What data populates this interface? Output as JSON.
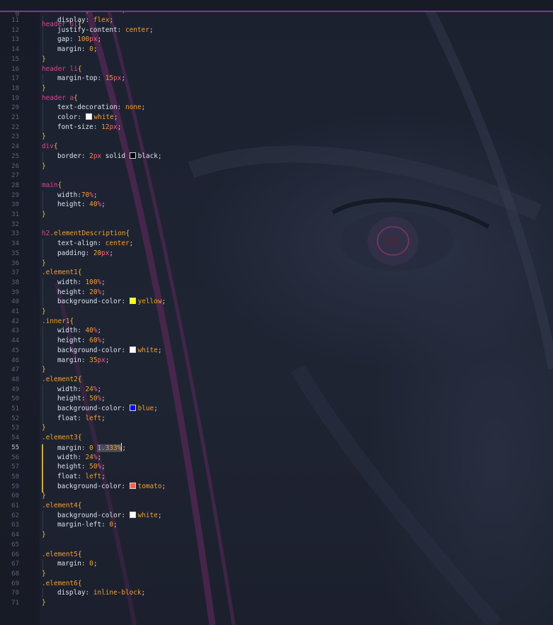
{
  "editor": {
    "active_line": "55",
    "sticky": {
      "num": "9",
      "tokens": [
        [
          "tag",
          "header "
        ],
        [
          "tag",
          "ul"
        ],
        [
          "brace",
          "{"
        ]
      ]
    },
    "partial": {
      "num": "10",
      "tokens": [
        [
          "faded",
          "    list-style: none;"
        ]
      ]
    },
    "lines": [
      {
        "num": "11",
        "indent": 1,
        "tokens": [
          [
            "prop",
            "display"
          ],
          [
            "punc",
            ": "
          ],
          [
            "val",
            "flex"
          ],
          [
            "punc",
            ";"
          ]
        ]
      },
      {
        "num": "12",
        "indent": 1,
        "tokens": [
          [
            "prop",
            "justify-content"
          ],
          [
            "punc",
            ": "
          ],
          [
            "val",
            "center"
          ],
          [
            "punc",
            ";"
          ]
        ]
      },
      {
        "num": "13",
        "indent": 1,
        "tokens": [
          [
            "prop",
            "gap"
          ],
          [
            "punc",
            ": "
          ],
          [
            "num",
            "100"
          ],
          [
            "unit",
            "px"
          ],
          [
            "punc",
            ";"
          ]
        ]
      },
      {
        "num": "14",
        "indent": 1,
        "tokens": [
          [
            "prop",
            "margin"
          ],
          [
            "punc",
            ": "
          ],
          [
            "num",
            "0"
          ],
          [
            "punc",
            ";"
          ]
        ]
      },
      {
        "num": "15",
        "indent": 0,
        "tokens": [
          [
            "brace",
            "}"
          ]
        ]
      },
      {
        "num": "16",
        "indent": 0,
        "tokens": [
          [
            "tag",
            "header "
          ],
          [
            "tag",
            "li"
          ],
          [
            "brace",
            "{"
          ]
        ]
      },
      {
        "num": "17",
        "indent": 1,
        "tokens": [
          [
            "prop",
            "margin-top"
          ],
          [
            "punc",
            ": "
          ],
          [
            "num",
            "15"
          ],
          [
            "unit",
            "px"
          ],
          [
            "punc",
            ";"
          ]
        ]
      },
      {
        "num": "18",
        "indent": 0,
        "tokens": [
          [
            "brace",
            "}"
          ]
        ]
      },
      {
        "num": "19",
        "indent": 0,
        "tokens": [
          [
            "tag",
            "header "
          ],
          [
            "tag",
            "a"
          ],
          [
            "brace",
            "{"
          ]
        ]
      },
      {
        "num": "20",
        "indent": 1,
        "tokens": [
          [
            "prop",
            "text-decoration"
          ],
          [
            "punc",
            ": "
          ],
          [
            "val",
            "none"
          ],
          [
            "punc",
            ";"
          ]
        ]
      },
      {
        "num": "21",
        "indent": 1,
        "tokens": [
          [
            "prop",
            "color"
          ],
          [
            "punc",
            ": "
          ],
          [
            "swatch",
            "#ffffff"
          ],
          [
            "val",
            "white"
          ],
          [
            "punc",
            ";"
          ]
        ]
      },
      {
        "num": "22",
        "indent": 1,
        "tokens": [
          [
            "prop",
            "font-size"
          ],
          [
            "punc",
            ": "
          ],
          [
            "num",
            "12"
          ],
          [
            "unit",
            "px"
          ],
          [
            "punc",
            ";"
          ]
        ]
      },
      {
        "num": "23",
        "indent": 0,
        "tokens": [
          [
            "brace",
            "}"
          ]
        ]
      },
      {
        "num": "24",
        "indent": 0,
        "tokens": [
          [
            "tag",
            "div"
          ],
          [
            "brace",
            "{"
          ]
        ]
      },
      {
        "num": "25",
        "indent": 1,
        "tokens": [
          [
            "prop",
            "border"
          ],
          [
            "punc",
            ": "
          ],
          [
            "num",
            "2"
          ],
          [
            "unit",
            "px"
          ],
          [
            "plain",
            " solid "
          ],
          [
            "swatch",
            "#000000"
          ],
          [
            "plain",
            "black"
          ],
          [
            "punc",
            ";"
          ]
        ]
      },
      {
        "num": "26",
        "indent": 0,
        "tokens": [
          [
            "brace",
            "}"
          ]
        ]
      },
      {
        "num": "27",
        "indent": 0,
        "tokens": []
      },
      {
        "num": "28",
        "indent": 0,
        "tokens": [
          [
            "tag",
            "main"
          ],
          [
            "brace",
            "{"
          ]
        ]
      },
      {
        "num": "29",
        "indent": 1,
        "tokens": [
          [
            "prop",
            "width"
          ],
          [
            "punc",
            ":"
          ],
          [
            "num",
            "70"
          ],
          [
            "unit",
            "%"
          ],
          [
            "punc",
            ";"
          ]
        ]
      },
      {
        "num": "30",
        "indent": 1,
        "tokens": [
          [
            "prop",
            "height"
          ],
          [
            "punc",
            ": "
          ],
          [
            "num",
            "40"
          ],
          [
            "unit",
            "%"
          ],
          [
            "punc",
            ";"
          ]
        ]
      },
      {
        "num": "31",
        "indent": 0,
        "tokens": [
          [
            "brace",
            "}"
          ]
        ]
      },
      {
        "num": "32",
        "indent": 0,
        "tokens": []
      },
      {
        "num": "33",
        "indent": 0,
        "tokens": [
          [
            "tag",
            "h2"
          ],
          [
            "cls",
            ".elementDescription"
          ],
          [
            "brace",
            "{"
          ]
        ]
      },
      {
        "num": "34",
        "indent": 1,
        "tokens": [
          [
            "prop",
            "text-align"
          ],
          [
            "punc",
            ": "
          ],
          [
            "val",
            "center"
          ],
          [
            "punc",
            ";"
          ]
        ]
      },
      {
        "num": "35",
        "indent": 1,
        "tokens": [
          [
            "prop",
            "padding"
          ],
          [
            "punc",
            ": "
          ],
          [
            "num",
            "20"
          ],
          [
            "unit",
            "px"
          ],
          [
            "punc",
            ";"
          ]
        ]
      },
      {
        "num": "36",
        "indent": 0,
        "tokens": [
          [
            "brace",
            "}"
          ]
        ]
      },
      {
        "num": "37",
        "indent": 0,
        "tokens": [
          [
            "cls",
            ".element1"
          ],
          [
            "brace",
            "{"
          ]
        ]
      },
      {
        "num": "38",
        "indent": 1,
        "tokens": [
          [
            "prop",
            "width"
          ],
          [
            "punc",
            ": "
          ],
          [
            "num",
            "100"
          ],
          [
            "unit",
            "%"
          ],
          [
            "punc",
            ";"
          ]
        ]
      },
      {
        "num": "39",
        "indent": 1,
        "tokens": [
          [
            "prop",
            "height"
          ],
          [
            "punc",
            ": "
          ],
          [
            "num",
            "20"
          ],
          [
            "unit",
            "%"
          ],
          [
            "punc",
            ";"
          ]
        ]
      },
      {
        "num": "40",
        "indent": 1,
        "tokens": [
          [
            "prop",
            "background-color"
          ],
          [
            "punc",
            ": "
          ],
          [
            "swatch",
            "#ffff00"
          ],
          [
            "val",
            "yellow"
          ],
          [
            "punc",
            ";"
          ]
        ]
      },
      {
        "num": "41",
        "indent": 0,
        "tokens": [
          [
            "brace",
            "}"
          ]
        ]
      },
      {
        "num": "42",
        "indent": 0,
        "tokens": [
          [
            "cls",
            ".inner1"
          ],
          [
            "brace",
            "{"
          ]
        ]
      },
      {
        "num": "43",
        "indent": 1,
        "tokens": [
          [
            "prop",
            "width"
          ],
          [
            "punc",
            ": "
          ],
          [
            "num",
            "40"
          ],
          [
            "unit",
            "%"
          ],
          [
            "punc",
            ";"
          ]
        ]
      },
      {
        "num": "44",
        "indent": 1,
        "tokens": [
          [
            "prop",
            "height"
          ],
          [
            "punc",
            ": "
          ],
          [
            "num",
            "60"
          ],
          [
            "unit",
            "%"
          ],
          [
            "punc",
            ";"
          ]
        ]
      },
      {
        "num": "45",
        "indent": 1,
        "tokens": [
          [
            "prop",
            "background-color"
          ],
          [
            "punc",
            ": "
          ],
          [
            "swatch",
            "#ffffff"
          ],
          [
            "val",
            "white"
          ],
          [
            "punc",
            ";"
          ]
        ]
      },
      {
        "num": "46",
        "indent": 1,
        "tokens": [
          [
            "prop",
            "margin"
          ],
          [
            "punc",
            ": "
          ],
          [
            "num",
            "35"
          ],
          [
            "unit",
            "px"
          ],
          [
            "punc",
            ";"
          ]
        ]
      },
      {
        "num": "47",
        "indent": 0,
        "tokens": [
          [
            "brace",
            "}"
          ]
        ]
      },
      {
        "num": "48",
        "indent": 0,
        "tokens": [
          [
            "cls",
            ".element2"
          ],
          [
            "brace",
            "{"
          ]
        ]
      },
      {
        "num": "49",
        "indent": 1,
        "tokens": [
          [
            "prop",
            "width"
          ],
          [
            "punc",
            ": "
          ],
          [
            "num",
            "24"
          ],
          [
            "unit",
            "%"
          ],
          [
            "punc",
            ";"
          ]
        ]
      },
      {
        "num": "50",
        "indent": 1,
        "tokens": [
          [
            "prop",
            "height"
          ],
          [
            "punc",
            ": "
          ],
          [
            "num",
            "50"
          ],
          [
            "unit",
            "%"
          ],
          [
            "punc",
            ";"
          ]
        ]
      },
      {
        "num": "51",
        "indent": 1,
        "tokens": [
          [
            "prop",
            "background-color"
          ],
          [
            "punc",
            ": "
          ],
          [
            "swatch",
            "#0000ff"
          ],
          [
            "val",
            "blue"
          ],
          [
            "punc",
            ";"
          ]
        ]
      },
      {
        "num": "52",
        "indent": 1,
        "tokens": [
          [
            "prop",
            "float"
          ],
          [
            "punc",
            ": "
          ],
          [
            "val",
            "left"
          ],
          [
            "punc",
            ";"
          ]
        ]
      },
      {
        "num": "53",
        "indent": 0,
        "tokens": [
          [
            "brace",
            "}"
          ]
        ]
      },
      {
        "num": "54",
        "indent": 0,
        "tokens": [
          [
            "cls",
            ".element3"
          ],
          [
            "brace",
            "{"
          ]
        ]
      },
      {
        "num": "55",
        "indent": 1,
        "tokens": [
          [
            "prop",
            "margin"
          ],
          [
            "punc",
            ": "
          ],
          [
            "num",
            "0 "
          ],
          [
            "hl",
            "1.333%"
          ],
          [
            "cursor",
            ""
          ],
          [
            "punc",
            ";"
          ]
        ]
      },
      {
        "num": "56",
        "indent": 1,
        "tokens": [
          [
            "prop",
            "width"
          ],
          [
            "punc",
            ": "
          ],
          [
            "num",
            "24"
          ],
          [
            "unit",
            "%"
          ],
          [
            "punc",
            ";"
          ]
        ]
      },
      {
        "num": "57",
        "indent": 1,
        "tokens": [
          [
            "prop",
            "height"
          ],
          [
            "punc",
            ": "
          ],
          [
            "num",
            "50"
          ],
          [
            "unit",
            "%"
          ],
          [
            "punc",
            ";"
          ]
        ]
      },
      {
        "num": "58",
        "indent": 1,
        "tokens": [
          [
            "prop",
            "float"
          ],
          [
            "punc",
            ": "
          ],
          [
            "val",
            "left"
          ],
          [
            "punc",
            ";"
          ]
        ]
      },
      {
        "num": "59",
        "indent": 1,
        "tokens": [
          [
            "prop",
            "background-color"
          ],
          [
            "punc",
            ": "
          ],
          [
            "swatch",
            "#ff6347"
          ],
          [
            "val",
            "tomato"
          ],
          [
            "punc",
            ";"
          ]
        ]
      },
      {
        "num": "60",
        "indent": 0,
        "tokens": [
          [
            "brace",
            "}"
          ]
        ]
      },
      {
        "num": "61",
        "indent": 0,
        "tokens": [
          [
            "cls",
            ".element4"
          ],
          [
            "brace",
            "{"
          ]
        ]
      },
      {
        "num": "62",
        "indent": 1,
        "tokens": [
          [
            "prop",
            "background-color"
          ],
          [
            "punc",
            ": "
          ],
          [
            "swatch",
            "#ffffff"
          ],
          [
            "val",
            "white"
          ],
          [
            "punc",
            ";"
          ]
        ]
      },
      {
        "num": "63",
        "indent": 1,
        "tokens": [
          [
            "prop",
            "margin-left"
          ],
          [
            "punc",
            ": "
          ],
          [
            "num",
            "0"
          ],
          [
            "punc",
            ";"
          ]
        ]
      },
      {
        "num": "64",
        "indent": 0,
        "tokens": [
          [
            "brace",
            "}"
          ]
        ]
      },
      {
        "num": "65",
        "indent": 0,
        "tokens": []
      },
      {
        "num": "66",
        "indent": 0,
        "tokens": [
          [
            "cls",
            ".element5"
          ],
          [
            "brace",
            "{"
          ]
        ]
      },
      {
        "num": "67",
        "indent": 1,
        "tokens": [
          [
            "prop",
            "margin"
          ],
          [
            "punc",
            ": "
          ],
          [
            "num",
            "0"
          ],
          [
            "punc",
            ";"
          ]
        ]
      },
      {
        "num": "68",
        "indent": 0,
        "tokens": [
          [
            "brace",
            "}"
          ]
        ]
      },
      {
        "num": "69",
        "indent": 0,
        "tokens": [
          [
            "cls",
            ".element6"
          ],
          [
            "brace",
            "{"
          ]
        ]
      },
      {
        "num": "70",
        "indent": 1,
        "tokens": [
          [
            "prop",
            "display"
          ],
          [
            "punc",
            ": "
          ],
          [
            "val",
            "inline-block"
          ],
          [
            "punc",
            ";"
          ]
        ]
      },
      {
        "num": "71",
        "indent": 0,
        "tokens": [
          [
            "brace",
            "}"
          ]
        ]
      }
    ]
  }
}
